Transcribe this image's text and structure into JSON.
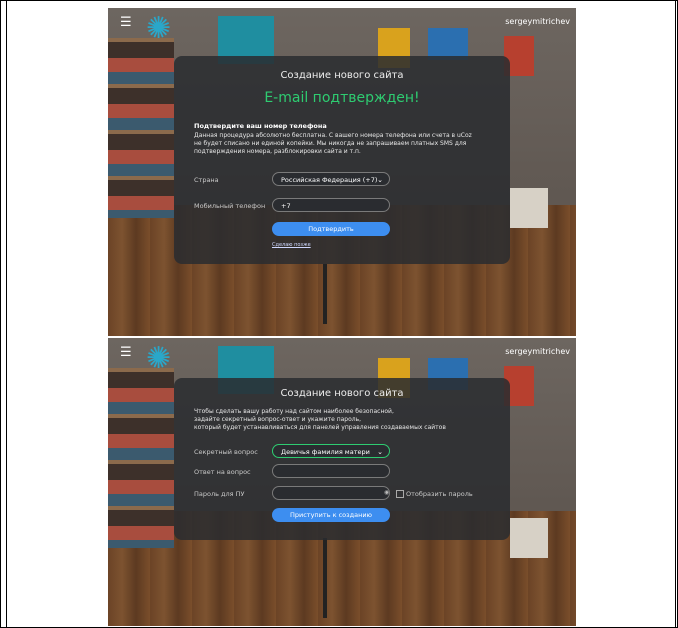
{
  "top": {
    "username": "sergeymitrichev",
    "title": "Создание нового сайта",
    "confirmed": "E-mail подтвержден!",
    "phone_heading": "Подтвердите ваш номер телефона",
    "info_lines": [
      "Данная процедура абсолютно бесплатна. С вашего номера телефона или счета в uCoz",
      "не будет списано ни единой копейки. Мы никогда не запрашиваем платных SMS для",
      "подтверждения номера, разблокировки сайта и т.п."
    ],
    "country_label": "Страна",
    "country_value": "Российская Федерация (+7)",
    "phone_label": "Мобильный телефон",
    "phone_value": "+7",
    "confirm_button": "Подтвердить",
    "later_link": "Сделаю позже"
  },
  "bottom": {
    "username": "sergeymitrichev",
    "title": "Создание нового сайта",
    "info_lines": [
      "Чтобы сделать вашу работу над сайтом наиболее безопасной,",
      "задайте секретный вопрос-ответ и укажите пароль,",
      "который будет устанавливаться для панелей управления создаваемых сайтов"
    ],
    "question_label": "Секретный вопрос",
    "question_value": "Девичья фамилия матери",
    "answer_label": "Ответ на вопрос",
    "password_label": "Пароль для ПУ",
    "show_password_label": "Отобразить пароль",
    "create_button": "Приступить к созданию"
  },
  "icons": {
    "menu": "hamburger-icon",
    "chevron": "chevron-down-icon",
    "eye": "eye-icon"
  },
  "colors": {
    "accent": "#3d8ef0",
    "success": "#2ecc71",
    "panel": "#2a2c30"
  }
}
